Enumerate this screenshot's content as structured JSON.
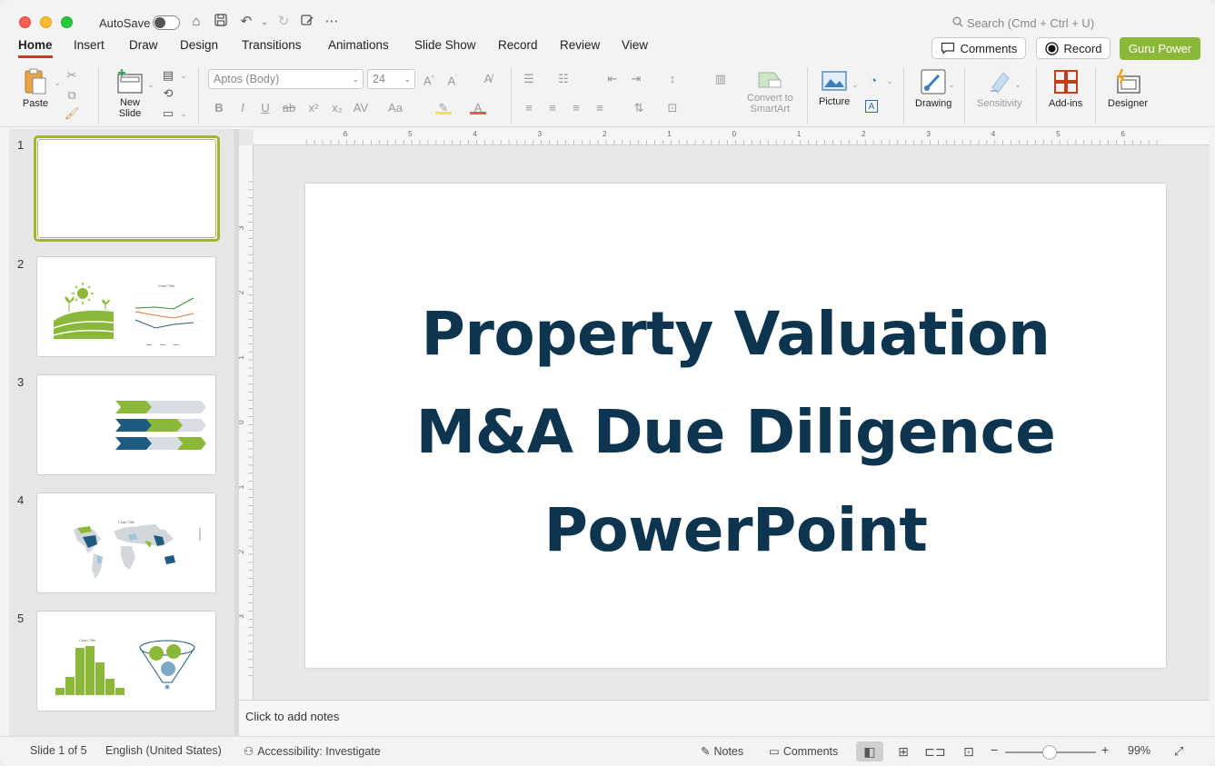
{
  "titlebar": {
    "autosave_label": "AutoSave",
    "search_placeholder": "Search (Cmd + Ctrl + U)"
  },
  "tabs": [
    "Home",
    "Insert",
    "Draw",
    "Design",
    "Transitions",
    "Animations",
    "Slide Show",
    "Record",
    "Review",
    "View"
  ],
  "active_tab": "Home",
  "header_buttons": {
    "comments": "Comments",
    "record": "Record",
    "guru": "Guru Power"
  },
  "ribbon": {
    "paste": "Paste",
    "new_slide_line1": "New",
    "new_slide_line2": "Slide",
    "font_name": "Aptos (Body)",
    "font_size": "24",
    "convert_line1": "Convert to",
    "convert_line2": "SmartArt",
    "picture": "Picture",
    "drawing": "Drawing",
    "sensitivity": "Sensitivity",
    "addins": "Add-ins",
    "designer": "Designer"
  },
  "thumbnails": [
    "1",
    "2",
    "3",
    "4",
    "5"
  ],
  "thumb_chart_title": "Chart Title",
  "ruler_h": [
    "6",
    "5",
    "4",
    "3",
    "2",
    "1",
    "0",
    "1",
    "2",
    "3",
    "4",
    "5",
    "6"
  ],
  "ruler_v": [
    "3",
    "2",
    "1",
    "0",
    "1",
    "2",
    "3"
  ],
  "slide": {
    "title_line1": "Property Valuation",
    "title_line2": "M&A Due Diligence",
    "title_line3": "PowerPoint",
    "title_color": "#0d3550"
  },
  "notes_placeholder": "Click to add notes",
  "status": {
    "slide_of": "Slide 1 of 5",
    "language": "English (United States)",
    "accessibility": "Accessibility: Investigate",
    "notes": "Notes",
    "comments": "Comments",
    "zoom": "99%"
  },
  "colors": {
    "accent_green": "#8cb83a",
    "dark_teal": "#1f5a80",
    "tab_underline": "#c43e1c"
  }
}
